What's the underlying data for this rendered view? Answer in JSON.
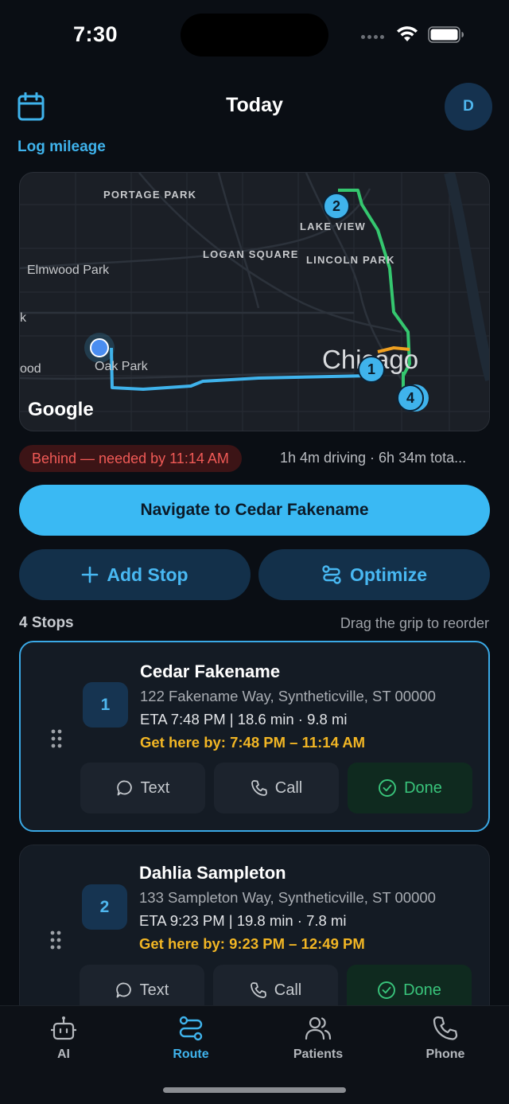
{
  "status_bar": {
    "time": "7:30"
  },
  "header": {
    "title": "Today",
    "avatar_initial": "D",
    "log_mileage": "Log mileage"
  },
  "map": {
    "labels": {
      "portage_park": "PORTAGE PARK",
      "lake_view": "LAKE VIEW",
      "logan_square": "LOGAN SQUARE",
      "lincoln_park": "LINCOLN PARK",
      "elmwood_park": "Elmwood Park",
      "oak_park": "Oak Park",
      "chicago": "Chicago",
      "edge_k": "k",
      "edge_ood": "ood"
    },
    "attribution": "Google",
    "pins": [
      "1",
      "2",
      "4"
    ],
    "route_colors": {
      "primary": "#3fb3ec",
      "green": "#35c76f",
      "orange": "#f0a020"
    }
  },
  "route_status": {
    "badge": "Behind — needed by 11:14 AM",
    "summary": "1h 4m driving · 6h 34m tota..."
  },
  "actions": {
    "navigate": "Navigate to Cedar Fakename",
    "add_stop": "Add Stop",
    "optimize": "Optimize"
  },
  "stops_header": {
    "count": "4 Stops",
    "hint": "Drag the grip to reorder"
  },
  "stops": [
    {
      "number": "1",
      "name": "Cedar Fakename",
      "address": "122 Fakename Way, Syntheticville, ST 00000",
      "eta": "ETA 7:48 PM | 18.6 min · 9.8 mi",
      "window": "Get here by: 7:48 PM – 11:14 AM",
      "text_label": "Text",
      "call_label": "Call",
      "done_label": "Done"
    },
    {
      "number": "2",
      "name": "Dahlia Sampleton",
      "address": "133 Sampleton Way, Syntheticville, ST 00000",
      "eta": "ETA 9:23 PM | 19.8 min · 7.8 mi",
      "window": "Get here by: 9:23 PM – 12:49 PM",
      "text_label": "Text",
      "call_label": "Call",
      "done_label": "Done"
    }
  ],
  "tabs": [
    {
      "label": "AI",
      "icon": "robot-icon"
    },
    {
      "label": "Route",
      "icon": "route-icon"
    },
    {
      "label": "Patients",
      "icon": "users-icon"
    },
    {
      "label": "Phone",
      "icon": "phone-icon"
    }
  ],
  "colors": {
    "accent": "#3ab9f3",
    "behind": "#f05a56",
    "window": "#f2b624",
    "done": "#39c47b",
    "background": "#0a0e14"
  }
}
